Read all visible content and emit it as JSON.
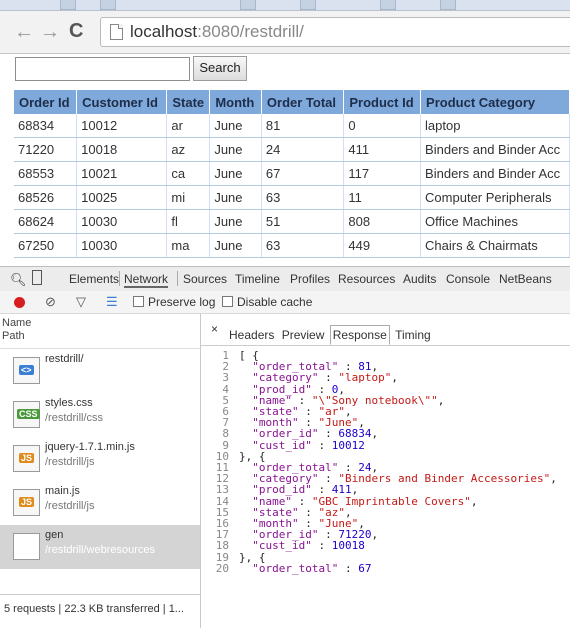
{
  "browser": {
    "url_host": "localhost",
    "url_rest": ":8080/restdrill/",
    "back_icon": "back-arrow-icon",
    "forward_icon": "forward-arrow-icon",
    "reload_icon": "reload-icon"
  },
  "page": {
    "search_value": "",
    "search_button": "Search",
    "table": {
      "headers": [
        "Order Id",
        "Customer Id",
        "State",
        "Month",
        "Order Total",
        "Product Id",
        "Product Category"
      ],
      "rows": [
        [
          "68834",
          "10012",
          "ar",
          "June",
          "81",
          "0",
          "laptop"
        ],
        [
          "71220",
          "10018",
          "az",
          "June",
          "24",
          "411",
          "Binders and Binder Acc"
        ],
        [
          "68553",
          "10021",
          "ca",
          "June",
          "67",
          "117",
          "Binders and Binder Acc"
        ],
        [
          "68526",
          "10025",
          "mi",
          "June",
          "63",
          "11",
          "Computer Peripherals"
        ],
        [
          "68624",
          "10030",
          "fl",
          "June",
          "51",
          "808",
          "Office Machines"
        ],
        [
          "67250",
          "10030",
          "ma",
          "June",
          "63",
          "449",
          "Chairs & Chairmats"
        ]
      ]
    },
    "colors": {
      "header_bg": "#7fa9db",
      "row_border": "#b6c9e3"
    }
  },
  "devtools": {
    "tabs": [
      "Elements",
      "Network",
      "Sources",
      "Timeline",
      "Profiles",
      "Resources",
      "Audits",
      "Console",
      "NetBeans"
    ],
    "active_tab": "Network",
    "toolbar": {
      "preserve_log": "Preserve log",
      "disable_cache": "Disable cache"
    },
    "columns": {
      "name": "Name",
      "path": "Path"
    },
    "requests": [
      {
        "name": "restdrill/",
        "path": "",
        "icon": "html-file-icon",
        "badge": "<>"
      },
      {
        "name": "styles.css",
        "path": "/restdrill/css",
        "icon": "css-file-icon",
        "badge": "CSS"
      },
      {
        "name": "jquery-1.7.1.min.js",
        "path": "/restdrill/js",
        "icon": "js-file-icon",
        "badge": "JS"
      },
      {
        "name": "main.js",
        "path": "/restdrill/js",
        "icon": "js-file-icon",
        "badge": "JS"
      },
      {
        "name": "gen",
        "path": "/restdrill/webresources",
        "icon": "blank-file-icon",
        "badge": ""
      }
    ],
    "status_text": "5 requests | 22.3 KB transferred | 1...",
    "detail_tabs": [
      "Headers",
      "Preview",
      "Response",
      "Timing"
    ],
    "active_detail_tab": "Response",
    "response_lines": [
      "[ {",
      "  \"order_total\" : 81,",
      "  \"category\" : \"laptop\",",
      "  \"prod_id\" : 0,",
      "  \"name\" : \"\\\"Sony notebook\\\"\",",
      "  \"state\" : \"ar\",",
      "  \"month\" : \"June\",",
      "  \"order_id\" : 68834,",
      "  \"cust_id\" : 10012",
      "}, {",
      "  \"order_total\" : 24,",
      "  \"category\" : \"Binders and Binder Accessories\",",
      "  \"prod_id\" : 411,",
      "  \"name\" : \"GBC Imprintable Covers\",",
      "  \"state\" : \"az\",",
      "  \"month\" : \"June\",",
      "  \"order_id\" : 71220,",
      "  \"cust_id\" : 10018",
      "}, {",
      "  \"order_total\" : 67"
    ]
  }
}
